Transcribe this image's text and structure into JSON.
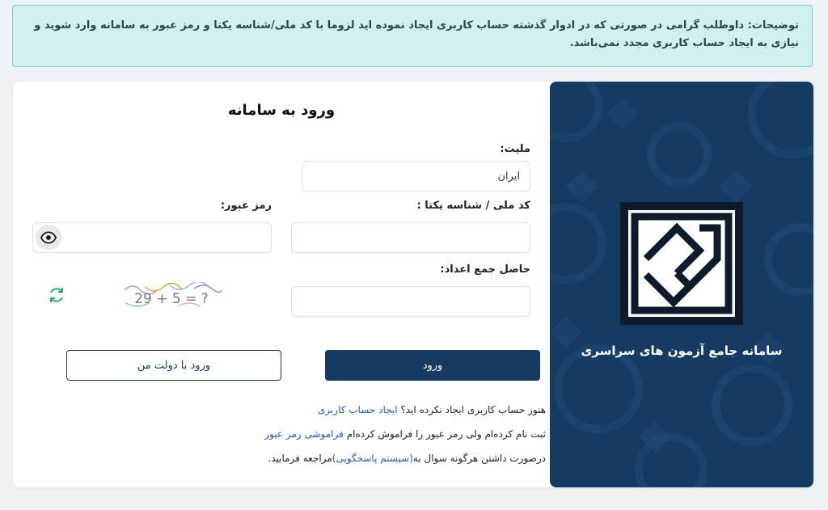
{
  "notice": {
    "text": "توضیحات: داوطلب گرامی در صورتی که در ادوار گذشته حساب کاربری ایجاد نموده اید لزوما با کد ملی/شناسه یکتا و رمز عبور به سامانه وارد شوید و نیازی به ایجاد حساب کاربری مجدد نمی‌باشد."
  },
  "brand": {
    "title": "سامانه جامع آزمون های سراسری"
  },
  "form": {
    "title": "ورود به سامانه",
    "nationality_label": "ملیت:",
    "nationality_value": "ایران",
    "national_code_label": "کد ملی / شناسه یکتا :",
    "password_label": "رمز عبور:",
    "sum_label": "حاصل جمع اعداد:",
    "captcha_text": "29 + 5 = ?",
    "login_button": "ورود",
    "dolat_button": "ورود با دولت من"
  },
  "help": {
    "no_account_text": "هنوز حساب کاربری ایجاد نکرده اید؟",
    "create_account_link": "ایجاد حساب کاربری",
    "forgot_text": "ثبت نام کرده‌ام ولی رمز عبور را فراموش کرده‌ام",
    "forgot_link": "فراموشی رمز عبور",
    "support_prefix": "درصورت داشتن هرگونه سوال به",
    "support_link": "(سیستم پاسخگویی)",
    "support_suffix": "مراجعه فرمایید."
  },
  "colors": {
    "primary": "#163b63",
    "notice_bg": "#d2f0f0",
    "notice_border": "#7ccfcf",
    "link": "#2a5ca8",
    "refresh": "#2ea86b"
  },
  "icons": [
    "eye-icon",
    "refresh-icon",
    "logo-icon"
  ]
}
